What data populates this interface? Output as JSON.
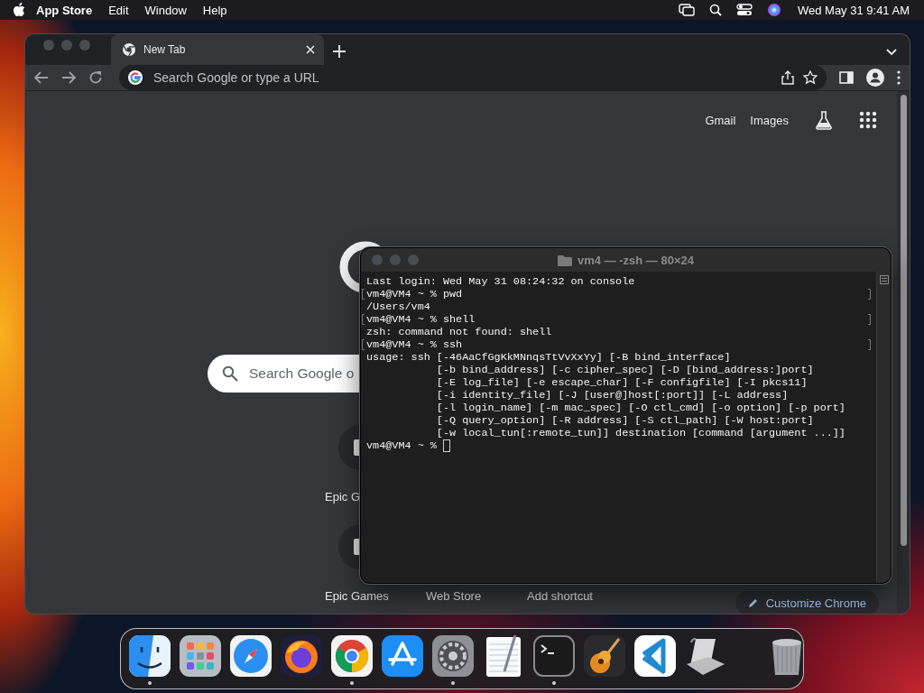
{
  "menu_bar": {
    "app_name": "App Store",
    "menus": [
      "Edit",
      "Window",
      "Help"
    ],
    "clock": "Wed May 31 9:41 AM"
  },
  "browser": {
    "tabs": [
      {
        "title": "New Tab",
        "selected": true
      }
    ],
    "address_bar": {
      "placeholder": "Search Google or type a URL"
    },
    "top_links": [
      "Gmail",
      "Images"
    ],
    "search_box": {
      "placeholder": "Search Google o"
    },
    "shortcut_rows": [
      [
        {
          "label": "Epic G"
        }
      ],
      [
        {
          "label": "Epic Games"
        },
        {
          "label": "Web Store"
        },
        {
          "label": "Add shortcut"
        }
      ]
    ],
    "customize_button": "Customize Chrome"
  },
  "terminal": {
    "title": "vm4 — -zsh — 80×24",
    "lines": [
      {
        "text": "Last login: Wed May 31 08:24:32 on console"
      },
      {
        "text": "vm4@VM4 ~ % pwd",
        "marked": true
      },
      {
        "text": "/Users/vm4"
      },
      {
        "text": "vm4@VM4 ~ % shell",
        "marked": true
      },
      {
        "text": "zsh: command not found: shell"
      },
      {
        "text": "vm4@VM4 ~ % ssh",
        "marked": true
      },
      {
        "text": "usage: ssh [-46AaCfGgKkMNnqsTtVvXxYy] [-B bind_interface]"
      },
      {
        "text": "           [-b bind_address] [-c cipher_spec] [-D [bind_address:]port]"
      },
      {
        "text": "           [-E log_file] [-e escape_char] [-F configfile] [-I pkcs11]"
      },
      {
        "text": "           [-i identity_file] [-J [user@]host[:port]] [-L address]"
      },
      {
        "text": "           [-l login_name] [-m mac_spec] [-O ctl_cmd] [-o option] [-p port]"
      },
      {
        "text": "           [-Q query_option] [-R address] [-S ctl_path] [-W host:port]"
      },
      {
        "text": "           [-w local_tun[:remote_tun]] destination [command [argument ...]]"
      },
      {
        "text": "vm4@VM4 ~ %",
        "cursor": true
      }
    ]
  },
  "dock": {
    "apps": [
      {
        "kind": "finder",
        "running": true
      },
      {
        "kind": "launchpad",
        "running": false
      },
      {
        "kind": "safari",
        "running": false
      },
      {
        "kind": "firefox",
        "running": false
      },
      {
        "kind": "chrome",
        "running": true
      },
      {
        "kind": "appstore",
        "running": false
      },
      {
        "kind": "settings",
        "running": true
      },
      {
        "kind": "textedit",
        "running": false
      },
      {
        "kind": "terminal",
        "running": true
      },
      {
        "kind": "garageband",
        "running": false
      },
      {
        "kind": "vscode",
        "running": false
      },
      {
        "kind": "script",
        "running": false
      }
    ],
    "trash": {
      "running": false
    }
  }
}
